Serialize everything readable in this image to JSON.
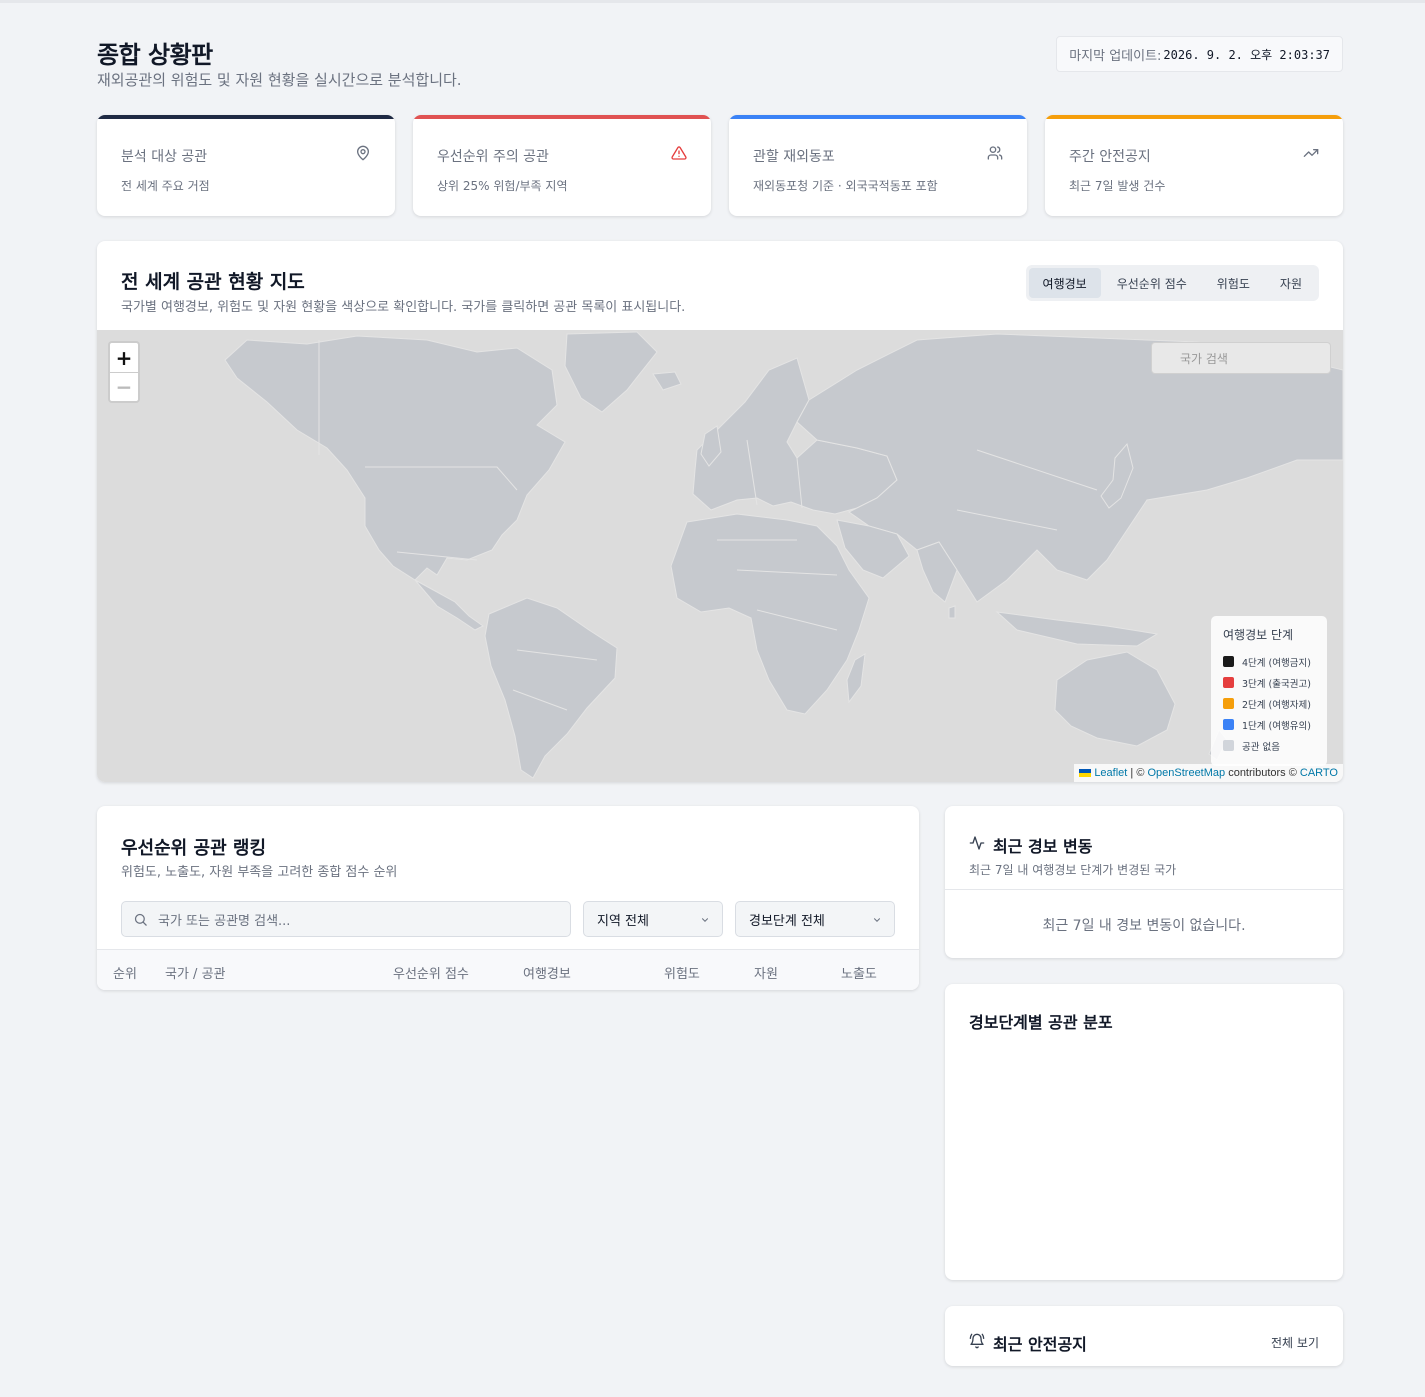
{
  "header": {
    "title": "종합 상황판",
    "subtitle": "재외공관의 위험도 및 자원 현황을 실시간으로 분석합니다.",
    "last_update_label": "마지막 업데이트:",
    "last_update_value": "2026. 9. 2. 오후 2:03:37"
  },
  "stats": [
    {
      "label": "분석 대상 공관",
      "sub": "전 세계 주요 거점",
      "icon": "map-pin-icon",
      "color": "#1f2a44"
    },
    {
      "label": "우선순위 주의 공관",
      "sub": "상위 25% 위험/부족 지역",
      "icon": "alert-triangle-icon",
      "color": "#e05252"
    },
    {
      "label": "관할 재외동포",
      "sub": "재외동포청 기준 · 외국국적동포 포함",
      "icon": "users-icon",
      "color": "#3b82f6"
    },
    {
      "label": "주간 안전공지",
      "sub": "최근 7일 발생 건수",
      "icon": "trending-up-icon",
      "color": "#f59e0b"
    }
  ],
  "map": {
    "title": "전 세계 공관 현황 지도",
    "subtitle": "국가별 여행경보, 위험도 및 자원 현황을 색상으로 확인합니다. 국가를 클릭하면 공관 목록이 표시됩니다.",
    "tabs": [
      "여행경보",
      "우선순위 점수",
      "위험도",
      "자원"
    ],
    "active_tab": "여행경보",
    "zoom_in": "+",
    "zoom_out": "−",
    "search_placeholder": "국가 검색",
    "legend_title": "여행경보 단계",
    "legend": [
      {
        "label": "4단계 (여행금지)",
        "color": "#1a1a1a"
      },
      {
        "label": "3단계 (출국권고)",
        "color": "#e53e3e"
      },
      {
        "label": "2단계 (여행자제)",
        "color": "#f59e0b"
      },
      {
        "label": "1단계 (여행유의)",
        "color": "#3b82f6"
      },
      {
        "label": "공관 없음",
        "color": "#d1d5db"
      }
    ],
    "attribution": {
      "leaflet": "Leaflet",
      "sep1": " | © ",
      "osm": "OpenStreetMap",
      "mid": " contributors © ",
      "carto": "CARTO"
    }
  },
  "ranking": {
    "title": "우선순위 공관 랭킹",
    "subtitle": "위험도, 노출도, 자원 부족을 고려한 종합 점수 순위",
    "search_placeholder": "국가 또는 공관명 검색...",
    "region_select": "지역 전체",
    "level_select": "경보단계 전체",
    "columns": [
      "순위",
      "국가 / 공관",
      "우선순위 점수",
      "여행경보",
      "위험도",
      "자원",
      "노출도"
    ]
  },
  "alerts": {
    "title": "최근 경보 변동",
    "subtitle": "최근 7일 내 여행경보 단계가 변경된 국가",
    "empty": "최근 7일 내 경보 변동이 없습니다."
  },
  "distribution": {
    "title": "경보단계별 공관 분포"
  },
  "notices": {
    "title": "최근 안전공지",
    "view_all": "전체 보기"
  }
}
